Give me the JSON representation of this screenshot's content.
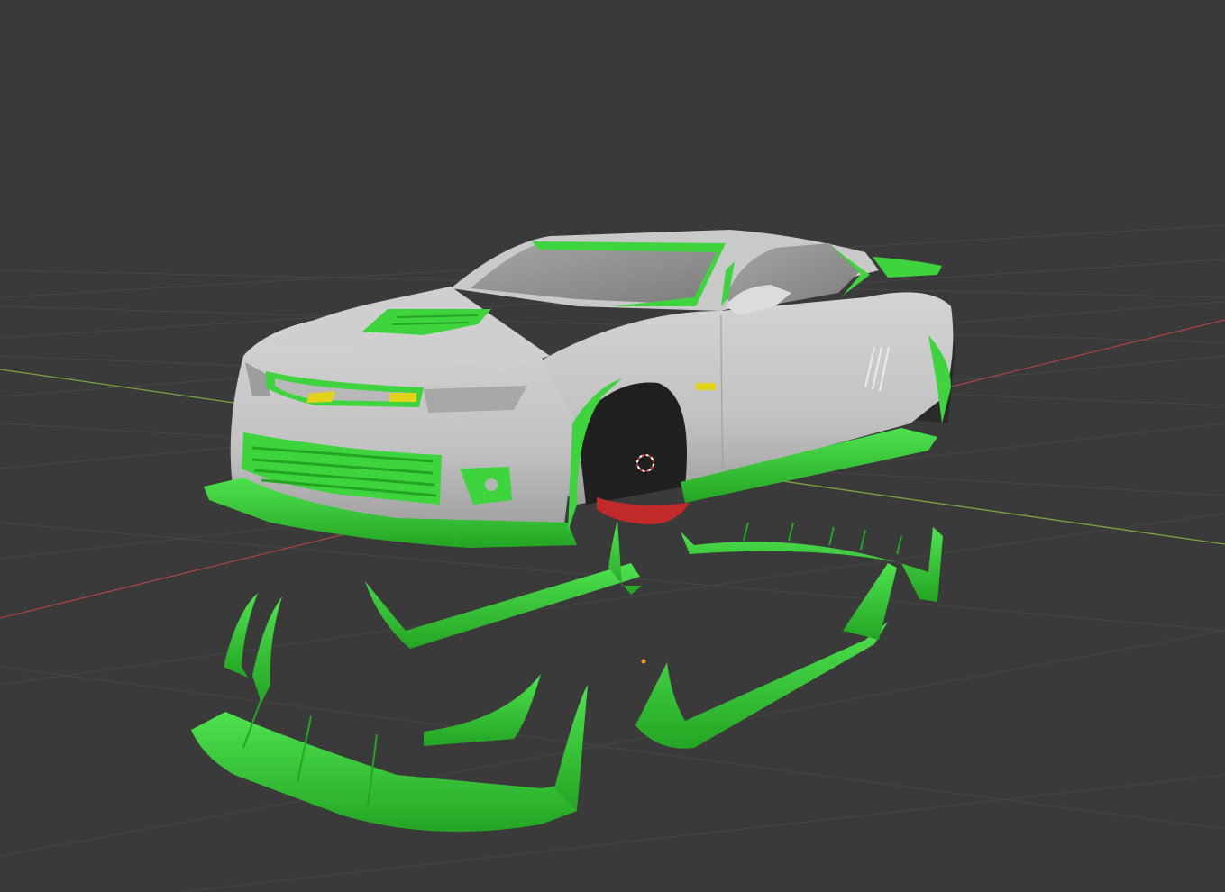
{
  "viewport": {
    "background": "#3a3a3a",
    "grid_color": "#474747",
    "x_axis_color": "#a84444",
    "y_axis_color": "#7fa443"
  },
  "colors": {
    "body_paint": "#c6c6c6",
    "body_shadow": "#9a9a9a",
    "glass": "#8f8f8f",
    "kit_part": "#3ed43e",
    "kit_part_dark": "#24a524",
    "brake_part": "#c22a2a",
    "logo": "#e2d219",
    "wheel_well": "#202020"
  },
  "icons": {
    "cursor": "3d-cursor-icon",
    "origin": "object-origin-icon"
  }
}
